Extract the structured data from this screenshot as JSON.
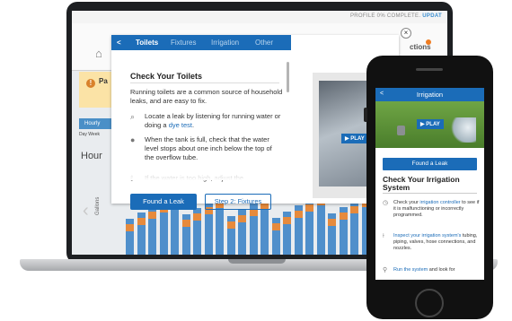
{
  "laptop": {
    "app": {
      "profile_text": "PROFILE 0% COMPLETE.",
      "update_link": "UPDAT",
      "home_icon": "home-icon",
      "actions_label": "ctions",
      "alert_text": "Pa",
      "hourly_tab": "Hourly",
      "subtabs": "Day   Week",
      "hou_text": "Hour",
      "gallons_label": "Gallons",
      "bar_colors": {
        "blue": "#4f8fcb",
        "orange": "#e68a3c"
      }
    },
    "modal": {
      "back": "<",
      "tabs": [
        "Toilets",
        "Fixtures",
        "Irrigation",
        "Other"
      ],
      "close": "×",
      "title": "Check Your Toilets",
      "intro": "Running toilets are a common source of household leaks, and are easy to fix.",
      "steps": [
        {
          "icon": "search-icon",
          "pre": "Locate a leak by listening for running water or doing a ",
          "link": "dye test",
          "post": "."
        },
        {
          "icon": "water-drop-icon",
          "pre": "When the tank is full, check that the water level stops about one inch below the top of the overflow tube.",
          "link": "",
          "post": ""
        },
        {
          "icon": "wrench-icon",
          "pre": "If the water is too high, adjust the",
          "link": "",
          "post": ""
        }
      ],
      "primary_button": "Found a Leak",
      "secondary_button": "Step 2: Fixtures",
      "play": "▶ PLAY"
    }
  },
  "phone": {
    "back": "<",
    "title": "Irrigation",
    "play": "▶ PLAY",
    "found_leak": "Found a Leak",
    "section_title": "Check Your Irrigation System",
    "steps": [
      {
        "icon": "clock-icon",
        "pre": "Check your ",
        "link": "irrigation controller",
        "post": " to see if it is malfunctioning or incorrectly programmed."
      },
      {
        "icon": "sprinkler-icon",
        "pre": "",
        "link": "Inspect your irrigation system's",
        "post": " tubing, piping, valves, hose connections, and nozzles."
      },
      {
        "icon": "tap-icon",
        "pre": "",
        "link": "Run the system",
        "post": " and look for"
      }
    ]
  }
}
